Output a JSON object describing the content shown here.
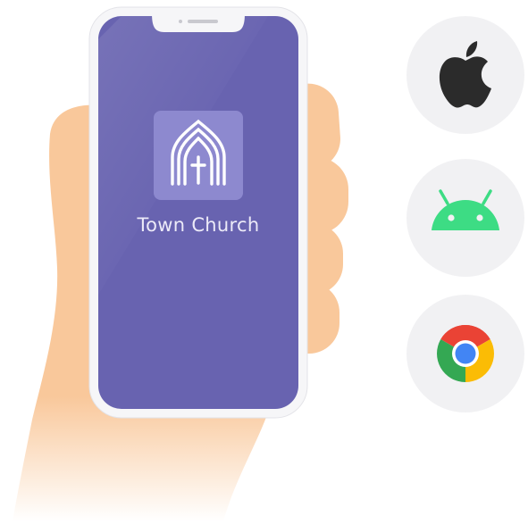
{
  "app": {
    "name": "Town Church",
    "screen_color": "#6863b0",
    "logo_tile_color": "#8d89cf"
  },
  "platforms": [
    {
      "name": "apple-icon",
      "color": "#2b2b2b"
    },
    {
      "name": "android-icon",
      "color": "#3ddc84"
    },
    {
      "name": "chrome-icon",
      "color": "#4285f4"
    }
  ],
  "colors": {
    "skin": "#f9c89b",
    "phone_frame": "#f6f6f8",
    "platform_bg": "#f1f1f3"
  }
}
